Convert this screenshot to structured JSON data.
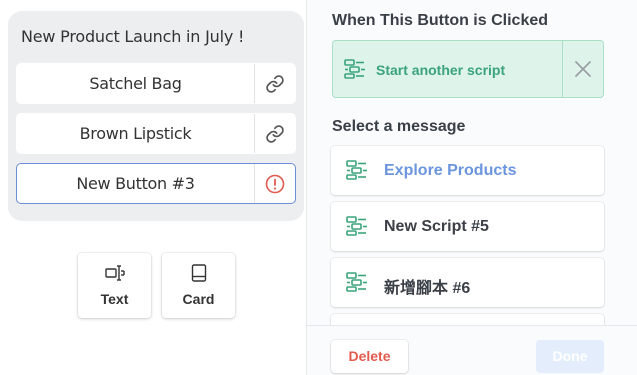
{
  "editor": {
    "title": "New Product Launch in July !",
    "buttons": [
      {
        "label": "Satchel Bag",
        "status_icon": "link-icon"
      },
      {
        "label": "Brown Lipstick",
        "status_icon": "link-icon"
      },
      {
        "label": "New Button #3",
        "status_icon": "warning-icon"
      }
    ],
    "add_options": [
      {
        "label": "Text",
        "icon": "text-icon"
      },
      {
        "label": "Card",
        "icon": "card-icon"
      }
    ]
  },
  "settings": {
    "click_heading": "When This Button is Clicked",
    "action": {
      "label": "Start another script",
      "icon": "script-icon"
    },
    "message_heading": "Select a message",
    "messages": [
      {
        "label": "Explore Products",
        "active": true
      },
      {
        "label": "New Script #5",
        "active": false
      },
      {
        "label": "新增腳本 #6",
        "active": false
      }
    ],
    "delete_label": "Delete",
    "done_label": "Done"
  },
  "colors": {
    "accent_blue": "#6b96de",
    "success_green": "#3aa37c",
    "danger_red": "#e15b4f"
  }
}
